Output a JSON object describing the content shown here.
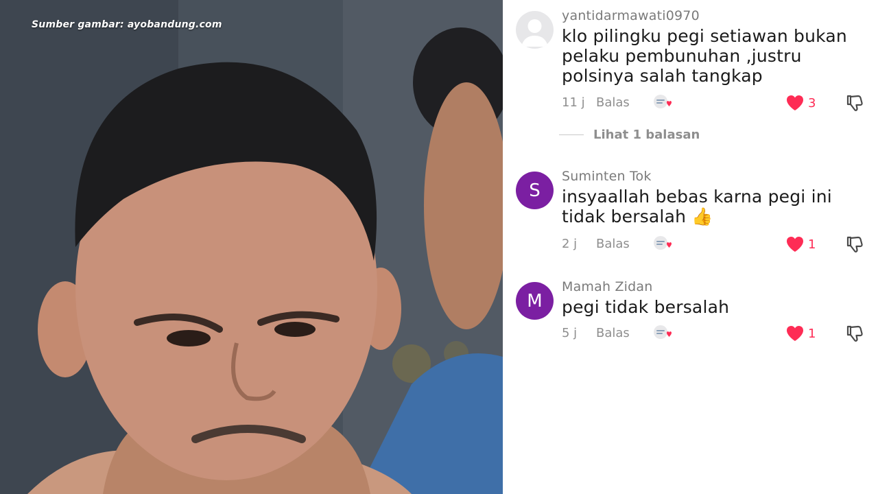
{
  "photo": {
    "caption": "Sumber gambar: ayobandung.com"
  },
  "comments": [
    {
      "avatar_type": "default",
      "avatar_letter": "",
      "username": "yantidarmawati0970",
      "text": "klo pilingku pegi setiawan bukan pelaku pembunuhan ,justru polsinya salah tangkap",
      "time": "11 j",
      "reply_label": "Balas",
      "likes": "3"
    },
    {
      "avatar_type": "letter",
      "avatar_letter": "S",
      "username": "Suminten Tok",
      "text": "insyaallah bebas karna pegi ini tidak bersalah 👍",
      "time": "2 j",
      "reply_label": "Balas",
      "likes": "1"
    },
    {
      "avatar_type": "letter",
      "avatar_letter": "M",
      "username": "Mamah Zidan",
      "text": "pegi tidak bersalah",
      "time": "5 j",
      "reply_label": "Balas",
      "likes": "1"
    }
  ],
  "view_replies": {
    "label": "Lihat 1 balasan"
  },
  "colors": {
    "avatar_purple": "#7b1fa2",
    "like_red": "#fe2c55",
    "meta_gray": "#8e8e8e"
  },
  "icons": {
    "like": "heart-icon",
    "dislike": "thumbs-down-icon",
    "gift": "gift-icon",
    "default_avatar": "user-silhouette-icon"
  }
}
